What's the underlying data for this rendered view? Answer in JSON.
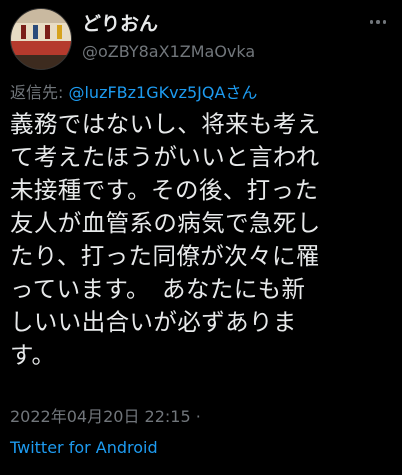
{
  "tweet": {
    "display_name": "どりおん",
    "handle": "@oZBY8aX1ZMaOvka",
    "reply_label": "返信先: ",
    "reply_handle": "@luzFBz1GKvz5JQAさん",
    "text": "義務ではないし、将来も考え\nて考えたほうがいいと言われ\n未接種です。その後、打った\n友人が血管系の病気で急死し\nたり、打った同僚が次々に罹\nっています。　あなたにも新\nしいい出合いが必ずありま\nす。",
    "timestamp": "2022年04月20日 22:15 ·",
    "source": "Twitter for Android"
  },
  "colors": {
    "background": "#000000",
    "primary_text": "#e7e9ea",
    "secondary_text": "#71767b",
    "link": "#1d9bf0"
  },
  "icons": {
    "more": "more-options-icon",
    "avatar": "profile-avatar"
  }
}
